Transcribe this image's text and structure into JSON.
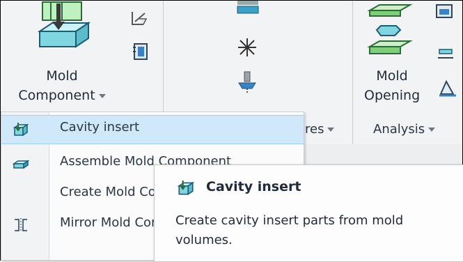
{
  "ribbon": {
    "mold_component": {
      "line1": "Mold",
      "line2": "Component"
    },
    "mold_opening": {
      "line1": "Mold",
      "line2": "Opening"
    },
    "groups": {
      "features_suffix": "res",
      "analysis": "Analysis"
    }
  },
  "menu": {
    "items": [
      {
        "label": "Cavity insert",
        "icon": "cavity-insert-icon",
        "highlighted": true
      },
      {
        "label": "Assemble Mold Component",
        "icon": "assemble-mold-component-icon"
      },
      {
        "label": "Create Mold Component",
        "icon": ""
      },
      {
        "label": "Mirror Mold Component",
        "icon": "mirror-icon"
      }
    ]
  },
  "tooltip": {
    "title": "Cavity insert",
    "description": "Create cavity insert parts from mold volumes."
  },
  "colors": {
    "highlight": "#cfe8fa",
    "icon_teal": "#7fd6e0",
    "icon_green": "#7fcf7a"
  }
}
